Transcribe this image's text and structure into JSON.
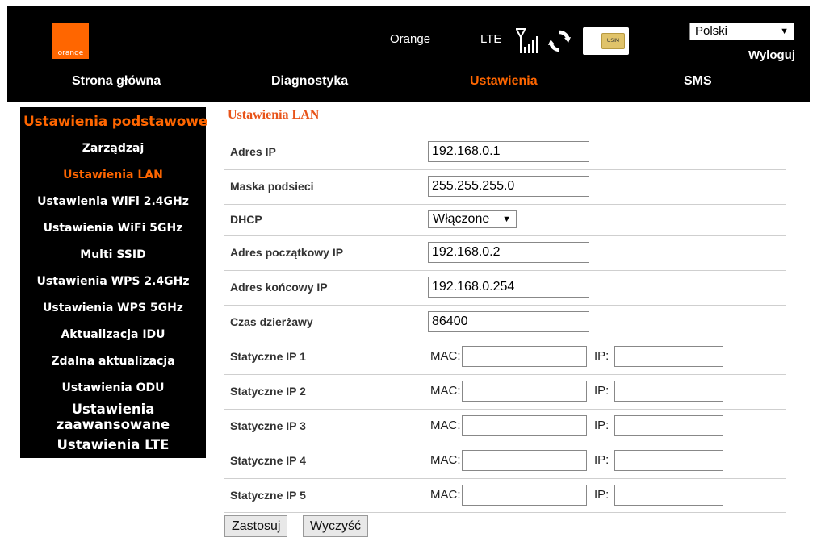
{
  "header": {
    "logo_text": "orange",
    "operator": "Orange",
    "network_type": "LTE",
    "signal_icon": "signal-bars-icon",
    "sync_icon": "sync-icon",
    "sim_label": "USIM",
    "language": "Polski",
    "logout": "Wyloguj",
    "brand_color": "#ff6600"
  },
  "nav": {
    "items": [
      "Strona główna",
      "Diagnostyka",
      "Ustawienia",
      "SMS"
    ],
    "active": "Ustawienia"
  },
  "sidebar": {
    "title": "Ustawienia podstawowe",
    "items": [
      "Zarządzaj",
      "Ustawienia LAN",
      "Ustawienia WiFi 2.4GHz",
      "Ustawienia WiFi 5GHz",
      "Multi SSID",
      "Ustawienia WPS 2.4GHz",
      "Ustawienia WPS 5GHz",
      "Aktualizacja IDU",
      "Zdalna aktualizacja",
      "Ustawienia ODU"
    ],
    "active": "Ustawienia LAN",
    "sections": [
      "Ustawienia zaawansowane",
      "Ustawienia LTE"
    ]
  },
  "main": {
    "title": "Ustawienia LAN",
    "fields": {
      "ip_address": {
        "label": "Adres IP",
        "value": "192.168.0.1"
      },
      "subnet_mask": {
        "label": "Maska podsieci",
        "value": "255.255.255.0"
      },
      "dhcp": {
        "label": "DHCP",
        "value": "Włączone"
      },
      "start_ip": {
        "label": "Adres początkowy IP",
        "value": "192.168.0.2"
      },
      "end_ip": {
        "label": "Adres końcowy IP",
        "value": "192.168.0.254"
      },
      "lease_time": {
        "label": "Czas dzierżawy",
        "value": "86400"
      }
    },
    "static_ips": [
      {
        "label": "Statyczne IP 1",
        "mac_label": "MAC:",
        "mac": "",
        "ip_label": "IP:",
        "ip": ""
      },
      {
        "label": "Statyczne IP 2",
        "mac_label": "MAC:",
        "mac": "",
        "ip_label": "IP:",
        "ip": ""
      },
      {
        "label": "Statyczne IP 3",
        "mac_label": "MAC:",
        "mac": "",
        "ip_label": "IP:",
        "ip": ""
      },
      {
        "label": "Statyczne IP 4",
        "mac_label": "MAC:",
        "mac": "",
        "ip_label": "IP:",
        "ip": ""
      },
      {
        "label": "Statyczne IP 5",
        "mac_label": "MAC:",
        "mac": "",
        "ip_label": "IP:",
        "ip": ""
      }
    ],
    "buttons": {
      "apply": "Zastosuj",
      "clear": "Wyczyść"
    }
  }
}
